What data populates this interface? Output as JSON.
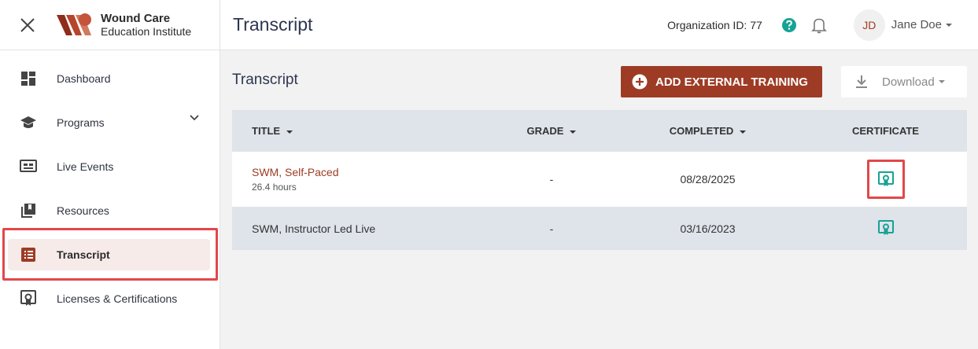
{
  "brand": {
    "title": "Wound Care",
    "subtitle": "Education Institute"
  },
  "header": {
    "title": "Transcript",
    "org_id": "Organization ID: 77",
    "user_initials": "JD",
    "user_name": "Jane Doe"
  },
  "sidebar": {
    "items": [
      {
        "label": "Dashboard",
        "icon": "dashboard-icon"
      },
      {
        "label": "Programs",
        "icon": "graduation-cap-icon"
      },
      {
        "label": "Live Events",
        "icon": "presentation-icon"
      },
      {
        "label": "Resources",
        "icon": "library-icon"
      },
      {
        "label": "Transcript",
        "icon": "list-icon",
        "active": true
      },
      {
        "label": "Licenses & Certifications",
        "icon": "certificate-icon"
      }
    ]
  },
  "main": {
    "section_title": "Transcript",
    "add_button": "ADD EXTERNAL TRAINING",
    "download_button": "Download",
    "columns": {
      "title": "TITLE",
      "grade": "GRADE",
      "completed": "COMPLETED",
      "certificate": "CERTIFICATE"
    },
    "rows": [
      {
        "title": "SWM, Self-Paced",
        "hours": "26.4 hours",
        "grade": "-",
        "completed": "08/28/2025"
      },
      {
        "title": "SWM, Instructor Led Live",
        "grade": "-",
        "completed": "03/16/2023"
      }
    ]
  },
  "colors": {
    "accent": "#9e3b25",
    "teal": "#16a394",
    "highlight": "#e2474a"
  }
}
